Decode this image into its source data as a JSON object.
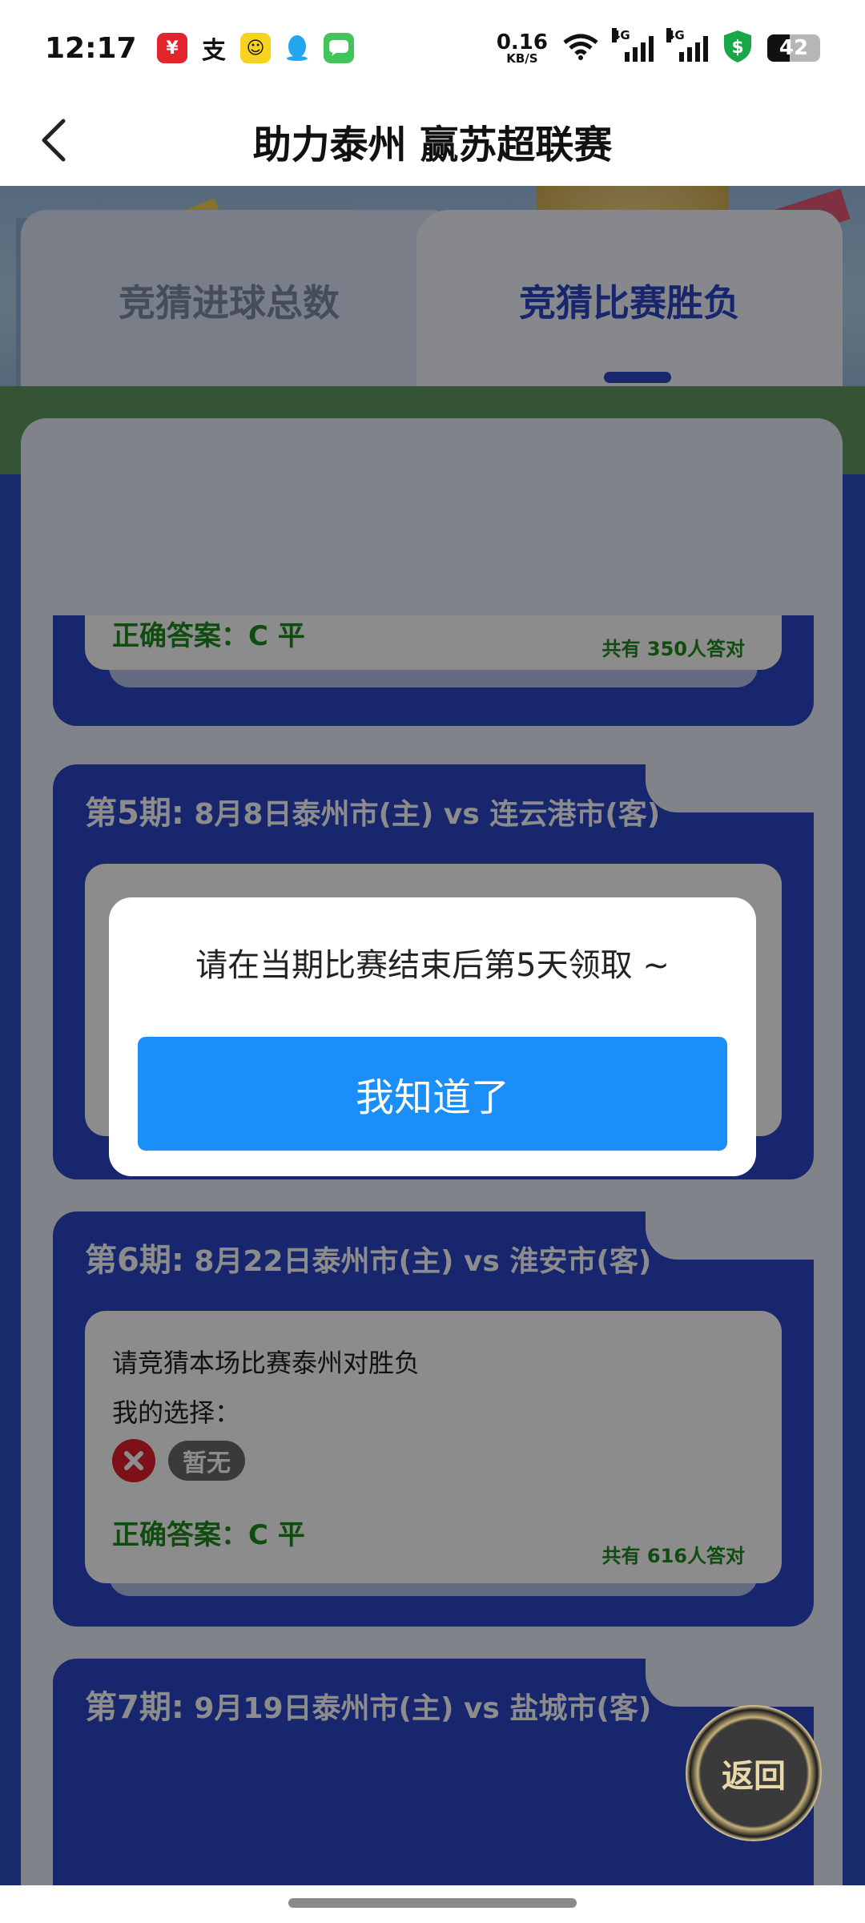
{
  "status_bar": {
    "time": "12:17",
    "net_speed_value": "0.16",
    "net_speed_unit": "KB/S",
    "sim1_type": "4G",
    "sim2_type": "4G",
    "battery": "42",
    "app_icons": [
      "yunshanfu-icon",
      "alipay-icon",
      "meituan-icon",
      "qq-icon",
      "messages-icon"
    ]
  },
  "nav": {
    "title": "助力泰州 赢苏超联赛"
  },
  "tabs": [
    {
      "label": "竞猜进球总数",
      "active": false
    },
    {
      "label": "竞猜比赛胜负",
      "active": true
    }
  ],
  "cards": [
    {
      "correct_answer": "正确答案：C 平",
      "answer_count": "共有 350人答对"
    },
    {
      "period": "第5期:",
      "match": "8月8日泰州市(主) vs 连云港市(客)"
    },
    {
      "period": "第6期:",
      "match": "8月22日泰州市(主) vs 淮安市(客)",
      "question": "请竞猜本场比赛泰州对胜负",
      "my_choice_label": "我的选择：",
      "my_choice_value": "暂无",
      "correct_answer": "正确答案：C 平",
      "answer_count": "共有 616人答对"
    },
    {
      "period": "第7期:",
      "match": "9月19日泰州市(主) vs 盐城市(客)"
    }
  ],
  "return_button": "返回",
  "dialog": {
    "message": "请在当期比赛结束后第5天领取 ~",
    "confirm": "我知道了"
  },
  "colors": {
    "primary_blue": "#2c48c7",
    "dialog_button": "#1a8ef9",
    "correct_green": "#1e8a1e",
    "wrong_red": "#e41f2a"
  }
}
